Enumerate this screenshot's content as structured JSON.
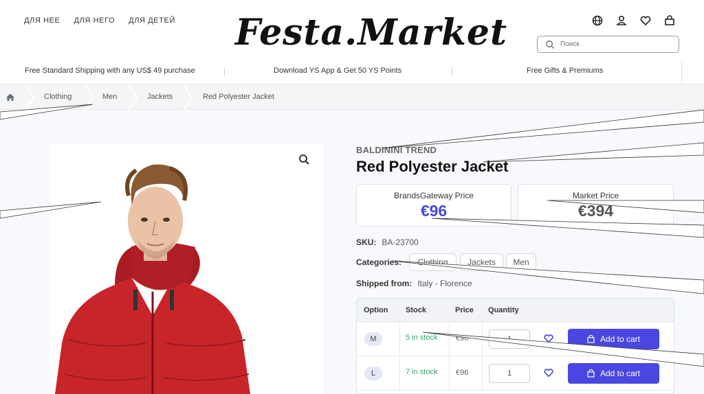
{
  "header": {
    "nav": [
      "ДЛЯ НЕЕ",
      "ДЛЯ НЕГО",
      "ДЛЯ ДЕТЕЙ"
    ],
    "logo": "Festa.Market",
    "icons": [
      "globe-icon",
      "user-icon",
      "heart-icon",
      "cart-icon"
    ],
    "search": {
      "placeholder": "Поиск",
      "value": ""
    }
  },
  "promo": [
    "Free Standard Shipping with any US$ 49 purchase",
    "Download YS App & Get 50 YS Points",
    "Free Gifts & Premiums"
  ],
  "breadcrumb": [
    "Clothing",
    "Men",
    "Jackets",
    "Red Polyester Jacket"
  ],
  "product": {
    "brand": "BALDININI TREND",
    "title": "Red Polyester Jacket",
    "brands_price_label": "BrandsGateway Price",
    "brands_price": "€96",
    "market_price_label": "Market Price",
    "market_price": "€394",
    "sku_label": "SKU:",
    "sku": "BA-23700",
    "categories_label": "Categories:",
    "categories": [
      "Clothing",
      "Jackets",
      "Men"
    ],
    "shipped_label": "Shipped from:",
    "shipped": "Italy - Florence"
  },
  "variants": {
    "headers": [
      "Option",
      "Stock",
      "Price",
      "Quantity"
    ],
    "add_label": "Add to cart",
    "rows": [
      {
        "option": "M",
        "stock": "5 in stock",
        "price": "€96",
        "qty": "1"
      },
      {
        "option": "L",
        "stock": "7 in stock",
        "price": "€96",
        "qty": "1"
      }
    ]
  },
  "colors": {
    "accent": "#4a47e0",
    "stock": "#2fa56a",
    "brand_price": "#4a47e0",
    "market_price": "#555555"
  }
}
